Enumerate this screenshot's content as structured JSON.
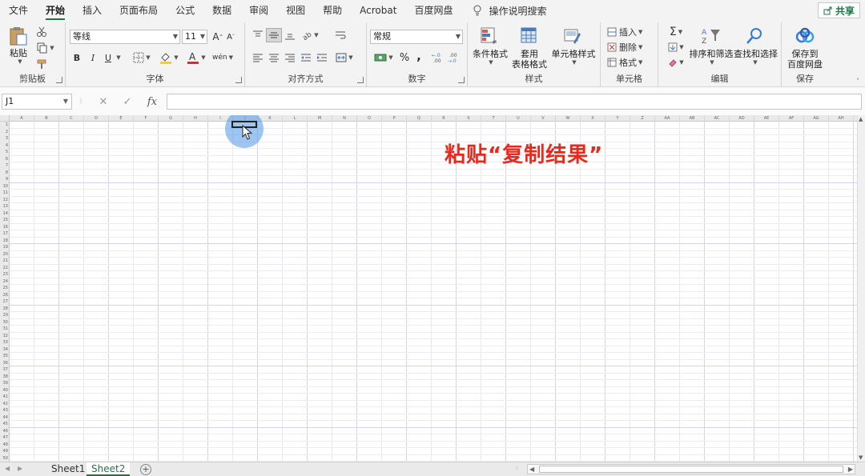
{
  "menu": {
    "tabs": [
      "文件",
      "开始",
      "插入",
      "页面布局",
      "公式",
      "数据",
      "审阅",
      "视图",
      "帮助",
      "Acrobat",
      "百度网盘"
    ],
    "active": "开始",
    "tell_me": "操作说明搜索",
    "share": "共享"
  },
  "ribbon": {
    "clipboard": {
      "label": "剪贴板",
      "paste": "粘贴"
    },
    "font": {
      "label": "字体",
      "font_name": "等线",
      "font_size": "11",
      "bold": "B",
      "italic": "I",
      "underline": "U"
    },
    "alignment": {
      "label": "对齐方式"
    },
    "number": {
      "label": "数字",
      "format": "常规",
      "percent": "%",
      "comma": ","
    },
    "styles": {
      "label": "样式",
      "conditional": "条件格式",
      "table_format_1": "套用",
      "table_format_2": "表格格式",
      "cell_styles": "单元格样式"
    },
    "cells": {
      "label": "单元格",
      "insert": "插入",
      "delete": "删除",
      "format": "格式"
    },
    "editing": {
      "label": "编辑",
      "sort_filter": "排序和筛选",
      "find_select": "查找和选择"
    },
    "save": {
      "label": "保存",
      "save_to_1": "保存到",
      "save_to_2": "百度网盘"
    }
  },
  "formula_bar": {
    "name_box": "J1",
    "fx": "fx",
    "content": ""
  },
  "grid": {
    "columns": [
      "A",
      "B",
      "C",
      "D",
      "E",
      "F",
      "G",
      "H",
      "I",
      "J",
      "K",
      "L",
      "M",
      "N",
      "O",
      "P",
      "Q",
      "R",
      "S",
      "T",
      "U",
      "V",
      "W",
      "X",
      "Y",
      "Z",
      "AA",
      "AB",
      "AC",
      "AD",
      "AE",
      "AF",
      "AG",
      "AH"
    ],
    "row_count": 50
  },
  "overlay_text": "粘贴“复制结果”",
  "sheets": [
    "Sheet1",
    "Sheet2"
  ],
  "active_sheet": "Sheet2",
  "colors": {
    "accent": "#217346",
    "overlay_text": "#e8291c",
    "cursor_highlight": "#5096e6"
  }
}
